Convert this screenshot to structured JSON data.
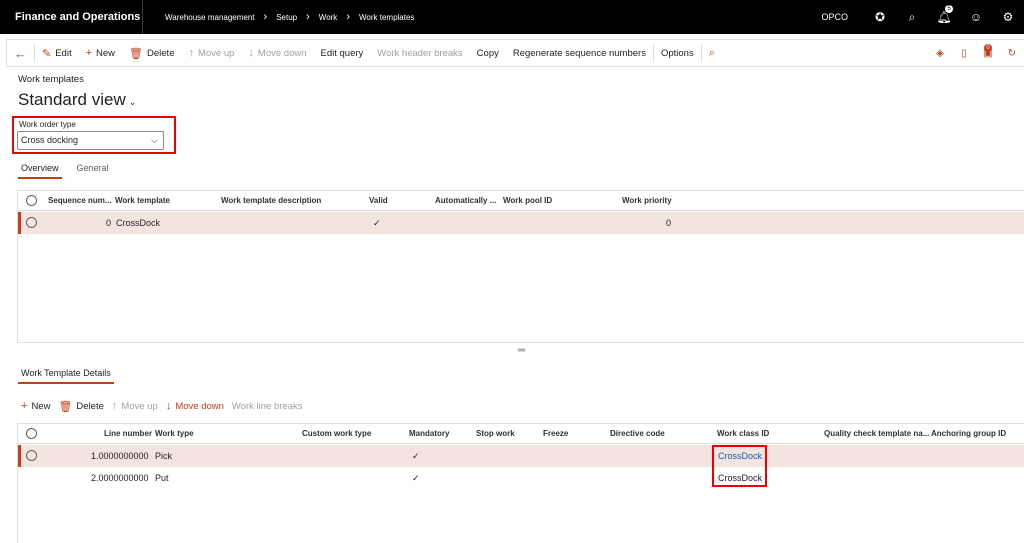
{
  "topbar": {
    "app_title": "Finance and Operations",
    "breadcrumb": [
      "Warehouse management",
      "Setup",
      "Work",
      "Work templates"
    ],
    "company": "OPCO",
    "notification_count": "5"
  },
  "actionbar": {
    "edit": "Edit",
    "new": "New",
    "delete": "Delete",
    "move_up": "Move up",
    "move_down": "Move down",
    "edit_query": "Edit query",
    "work_header_breaks": "Work header breaks",
    "copy": "Copy",
    "regenerate": "Regenerate sequence numbers",
    "options": "Options",
    "alert_count": "0"
  },
  "page": {
    "caption": "Work templates",
    "view": "Standard view"
  },
  "filter": {
    "label": "Work order type",
    "value": "Cross docking"
  },
  "tabs": [
    "Overview",
    "General"
  ],
  "header_grid": {
    "columns": [
      "Sequence num...",
      "Work template",
      "Work template description",
      "Valid",
      "Automatically ...",
      "Work pool ID",
      "Work priority"
    ],
    "rows": [
      {
        "sequence": "0",
        "template": "CrossDock",
        "description": "",
        "valid": "✓",
        "auto": "",
        "pool": "",
        "priority": "0"
      }
    ]
  },
  "details": {
    "section_title": "Work Template Details",
    "toolbar": {
      "new": "New",
      "delete": "Delete",
      "move_up": "Move up",
      "move_down": "Move down",
      "work_line_breaks": "Work line breaks"
    },
    "columns": [
      "Line number",
      "Work type",
      "Custom work type",
      "Mandatory",
      "Stop work",
      "Freeze",
      "Directive code",
      "Work class ID",
      "Quality check template na...",
      "Anchoring group ID"
    ],
    "rows": [
      {
        "line": "1.0000000000",
        "type": "Pick",
        "custom": "",
        "mandatory": "✓",
        "workclass": "CrossDock"
      },
      {
        "line": "2.0000000000",
        "type": "Put",
        "custom": "",
        "mandatory": "✓",
        "workclass": "CrossDock"
      }
    ]
  },
  "colors": {
    "accent": "#c43e1c",
    "highlight_box": "#ee0000",
    "selected_row": "#f4e4e0",
    "topbar": "#000000"
  }
}
